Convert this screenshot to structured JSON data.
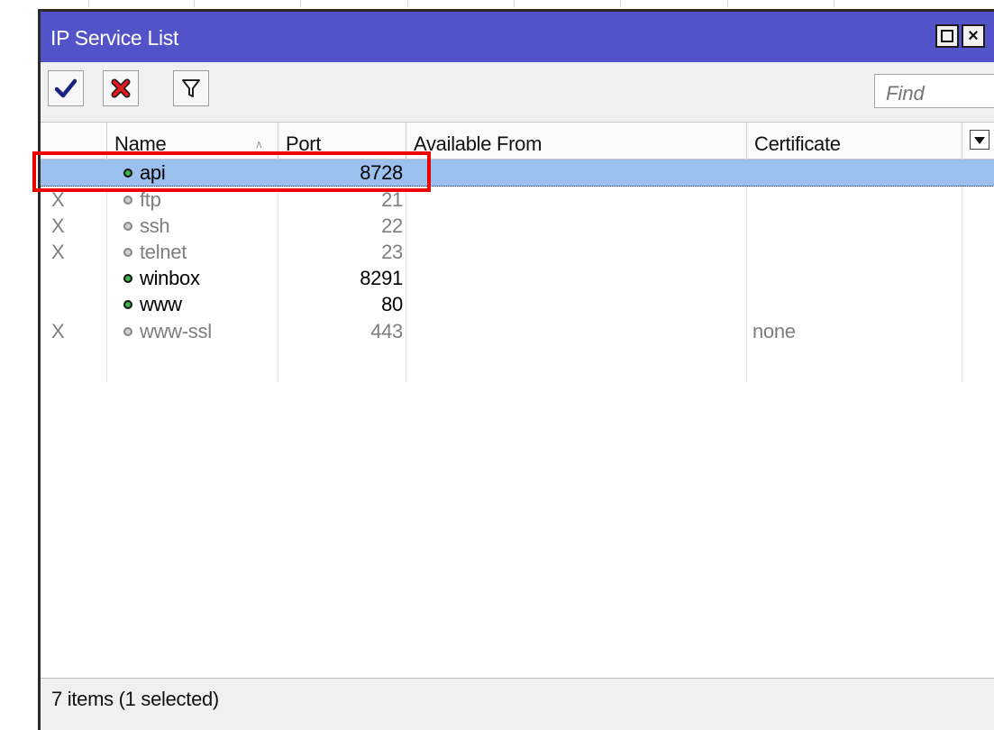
{
  "window": {
    "title": "IP Service List"
  },
  "toolbar": {
    "find_placeholder": "Find"
  },
  "columns": {
    "name": "Name",
    "port": "Port",
    "available_from": "Available From",
    "certificate": "Certificate"
  },
  "rows": [
    {
      "flag": "",
      "name": "api",
      "port": "8728",
      "available_from": "",
      "certificate": "",
      "enabled": true,
      "selected": true
    },
    {
      "flag": "X",
      "name": "ftp",
      "port": "21",
      "available_from": "",
      "certificate": "",
      "enabled": false,
      "selected": false
    },
    {
      "flag": "X",
      "name": "ssh",
      "port": "22",
      "available_from": "",
      "certificate": "",
      "enabled": false,
      "selected": false
    },
    {
      "flag": "X",
      "name": "telnet",
      "port": "23",
      "available_from": "",
      "certificate": "",
      "enabled": false,
      "selected": false
    },
    {
      "flag": "",
      "name": "winbox",
      "port": "8291",
      "available_from": "",
      "certificate": "",
      "enabled": true,
      "selected": false
    },
    {
      "flag": "",
      "name": "www",
      "port": "80",
      "available_from": "",
      "certificate": "",
      "enabled": true,
      "selected": false
    },
    {
      "flag": "X",
      "name": "www-ssl",
      "port": "443",
      "available_from": "",
      "certificate": "none",
      "enabled": false,
      "selected": false
    }
  ],
  "status": {
    "text": "7 items (1 selected)"
  },
  "icons": {
    "enable": "check-icon",
    "disable": "cross-icon",
    "filter": "filter-icon",
    "maximize": "maximize-icon",
    "close": "close-icon",
    "columns": "chevron-down-icon"
  },
  "colors": {
    "titlebar": "#5253c9",
    "selection": "#9cc0ee",
    "highlight": "#ee0000",
    "enabled_dot": "#3ab54a",
    "disabled_text": "#7e7e7e"
  }
}
